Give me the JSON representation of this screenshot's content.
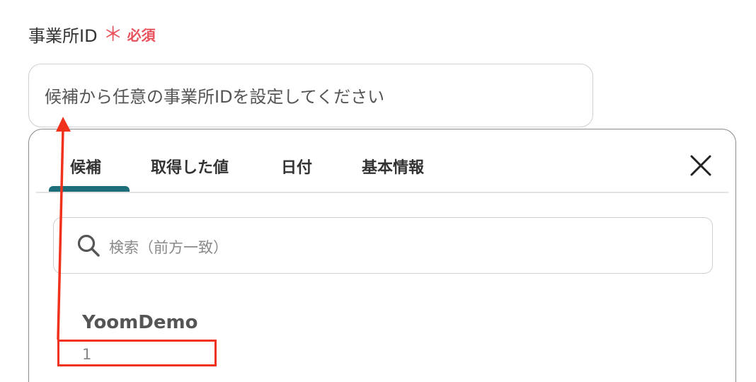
{
  "field": {
    "label": "事業所ID",
    "required_mark": "＊",
    "required_text": "必須"
  },
  "input": {
    "placeholder": "候補から任意の事業所IDを設定してください"
  },
  "tabs": [
    {
      "label": "候補",
      "active": true
    },
    {
      "label": "取得した値",
      "active": false
    },
    {
      "label": "日付",
      "active": false
    },
    {
      "label": "基本情報",
      "active": false
    }
  ],
  "search": {
    "placeholder": "検索（前方一致）"
  },
  "options": [
    {
      "title": "YoomDemo",
      "id": "1"
    }
  ],
  "colors": {
    "required": "#e8505b",
    "tab_accent": "#1d6d7a",
    "annotation": "#f0311c"
  },
  "icons": {
    "close": "close-icon",
    "search": "search-icon"
  }
}
